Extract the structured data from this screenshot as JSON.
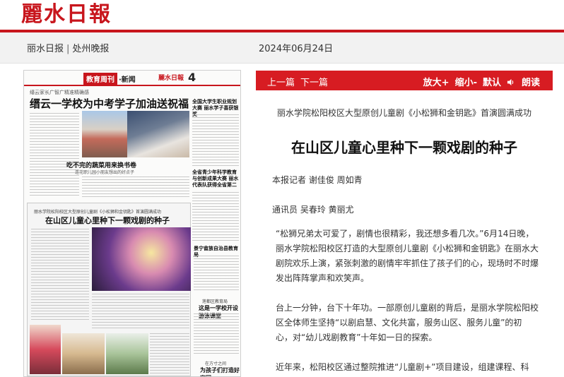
{
  "header": {
    "logo_text": "麗水日報",
    "papers": [
      "丽水日报",
      "处州晚报"
    ],
    "separator": "|",
    "date": "2024年06月24日"
  },
  "thumbnail": {
    "badge": "教育周刊",
    "section": "·新闻",
    "mini_logo": "麗水日報",
    "page_number": "4",
    "kicker": "缙云家长广智广精准精确感",
    "headline": "缙云一学校为中考学子加油送祝福",
    "headline2": "吃不完的蔬菜用来换书卷",
    "headline2_sub": "连花职儿园小朋友想出的好点子",
    "side_title_1": "全国大学生职业规划大赛 丽水学子喜获银奖",
    "side_title_2": "全省青少年科学教育与创新成果大赛 丽水代表队获得全省第二",
    "side_title_3": "景宁畲族自治县教育局",
    "kicker2": "丽水学院松阳校区大型原创儿童剧《小松狮和金钥匙》首演圆满成功",
    "main_headline": "在山区儿童心里种下一颗戏剧的种子",
    "small_kicker_1": "莲都区教育局",
    "small_headline_1": "这是一学校开设游泳课堂",
    "small_kicker_2": "在方寸之间",
    "small_headline_2": "为孩子们打造好家园"
  },
  "toolbar": {
    "prev": "上一篇",
    "next": "下一篇",
    "zoom_in": "放大+",
    "zoom_out": "缩小-",
    "default": "默认",
    "read_aloud": "朗读"
  },
  "article": {
    "subtitle": "丽水学院松阳校区大型原创儿童剧《小松狮和金钥匙》首演圆满成功",
    "title": "在山区儿童心里种下一颗戏剧的种子",
    "byline": "本报记者 谢佳俊 周如青",
    "byline2": "通讯员 吴春玲 黄丽尤",
    "paragraph_1": "“松狮兄弟太可爱了，剧情也很精彩，我还想多看几次。”6月14日晚，丽水学院松阳校区打造的大型原创儿童剧《小松狮和金钥匙》在丽水大剧院欢乐上演，紧张刺激的剧情牢牢抓住了孩子们的心，现场时不时爆发出阵阵掌声和欢笑声。",
    "paragraph_2": "台上一分钟，台下十年功。一部原创儿童剧的背后，是丽水学院松阳校区全体师生坚持“以剧启慧、文化共富，服务山区、服务儿童”的初心，对“幼儿戏剧教育”十年如一日的探索。",
    "paragraph_3": "近年来，松阳校区通过整院推进“儿童剧+”项目建设，组建课程、科"
  },
  "colors": {
    "brand_red": "#c8161d",
    "toolbar_red": "#d71c22"
  }
}
